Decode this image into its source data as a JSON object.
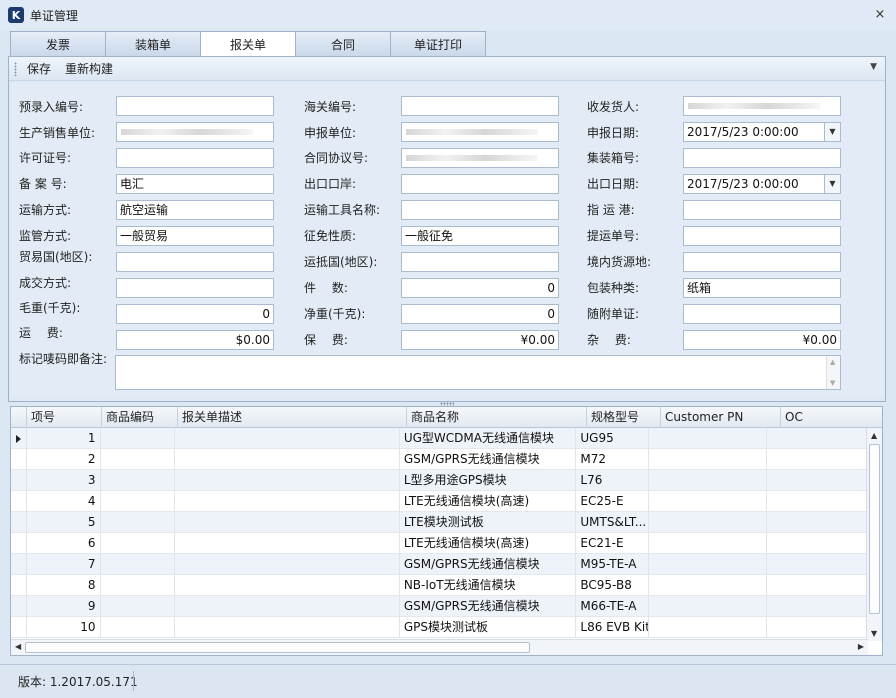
{
  "window": {
    "title": "单证管理",
    "close": "×",
    "app_icon": "K"
  },
  "tabs": [
    "发票",
    "装箱单",
    "报关单",
    "合同",
    "单证打印"
  ],
  "active_tab": 2,
  "toolbar": {
    "save": "保存",
    "rebuild": "重新构建"
  },
  "form": {
    "pre_entry_no": {
      "label": "预录入编号:",
      "value": ""
    },
    "customs_no": {
      "label": "海关编号:",
      "value": ""
    },
    "consignee": {
      "label": "收发货人:",
      "value": ""
    },
    "producer": {
      "label": "生产销售单位:",
      "value": ""
    },
    "declarer": {
      "label": "申报单位:",
      "value": ""
    },
    "declare_date": {
      "label": "申报日期:",
      "value": "2017/5/23 0:00:00"
    },
    "license_no": {
      "label": "许可证号:",
      "value": ""
    },
    "contract_no": {
      "label": "合同协议号:",
      "value": ""
    },
    "container_no": {
      "label": "集装箱号:",
      "value": ""
    },
    "record_no": {
      "label": "备 案 号:",
      "value": "电汇"
    },
    "export_port": {
      "label": "出口口岸:",
      "value": ""
    },
    "export_date": {
      "label": "出口日期:",
      "value": "2017/5/23 0:00:00"
    },
    "transport_mode": {
      "label": "运输方式:",
      "value": "航空运输"
    },
    "transport_tool": {
      "label": "运输工具名称:",
      "value": ""
    },
    "dest_port": {
      "label": "指 运 港:",
      "value": ""
    },
    "supervision": {
      "label": "监管方式:",
      "value": "一般贸易"
    },
    "tax_nature": {
      "label": "征免性质:",
      "value": "一般征免"
    },
    "bill_no": {
      "label": "提运单号:",
      "value": ""
    },
    "trade_country": {
      "label": "贸易国(地区):",
      "value": ""
    },
    "arrival_country": {
      "label": "运抵国(地区):",
      "value": ""
    },
    "source_place": {
      "label": "境内货源地:",
      "value": ""
    },
    "deal_mode": {
      "label": "成交方式:",
      "value": ""
    },
    "pieces": {
      "label": "件　 数:",
      "value": "0"
    },
    "package_type": {
      "label": "包装种类:",
      "value": "纸箱"
    },
    "gross_weight": {
      "label": "毛重(千克):",
      "value": "0"
    },
    "net_weight": {
      "label": "净重(千克):",
      "value": "0"
    },
    "attached_docs": {
      "label": "随附单证:",
      "value": ""
    },
    "freight": {
      "label": "运　 费:",
      "value": "$0.00"
    },
    "insurance": {
      "label": "保　 费:",
      "value": "¥0.00"
    },
    "misc_fee": {
      "label": "杂　 费:",
      "value": "¥0.00"
    },
    "marks_remarks": {
      "label": "标记唛码即备注:",
      "value": ""
    }
  },
  "grid": {
    "columns": [
      "项号",
      "商品编码",
      "报关单描述",
      "商品名称",
      "规格型号",
      "Customer PN",
      "OC"
    ],
    "rows": [
      {
        "idx": "1",
        "code": "",
        "desc": "",
        "name": "UG型WCDMA无线通信模块",
        "model": "UG95",
        "pn": "",
        "oc": ""
      },
      {
        "idx": "2",
        "code": "",
        "desc": "",
        "name": "GSM/GPRS无线通信模块",
        "model": "M72",
        "pn": "",
        "oc": ""
      },
      {
        "idx": "3",
        "code": "",
        "desc": "",
        "name": "L型多用途GPS模块",
        "model": "L76",
        "pn": "",
        "oc": ""
      },
      {
        "idx": "4",
        "code": "",
        "desc": "",
        "name": "LTE无线通信模块(高速)",
        "model": "EC25-E",
        "pn": "",
        "oc": ""
      },
      {
        "idx": "5",
        "code": "",
        "desc": "",
        "name": "LTE模块测试板",
        "model": "UMTS&LT...",
        "pn": "",
        "oc": ""
      },
      {
        "idx": "6",
        "code": "",
        "desc": "",
        "name": "LTE无线通信模块(高速)",
        "model": "EC21-E",
        "pn": "",
        "oc": ""
      },
      {
        "idx": "7",
        "code": "",
        "desc": "",
        "name": "GSM/GPRS无线通信模块",
        "model": "M95-TE-A",
        "pn": "",
        "oc": ""
      },
      {
        "idx": "8",
        "code": "",
        "desc": "",
        "name": "NB-IoT无线通信模块",
        "model": "BC95-B8",
        "pn": "",
        "oc": ""
      },
      {
        "idx": "9",
        "code": "",
        "desc": "",
        "name": "GSM/GPRS无线通信模块",
        "model": "M66-TE-A",
        "pn": "",
        "oc": ""
      },
      {
        "idx": "10",
        "code": "",
        "desc": "",
        "name": "GPS模块测试板",
        "model": "L86 EVB Kit",
        "pn": "",
        "oc": ""
      }
    ]
  },
  "status": {
    "version": "版本: 1.2017.05.171"
  }
}
